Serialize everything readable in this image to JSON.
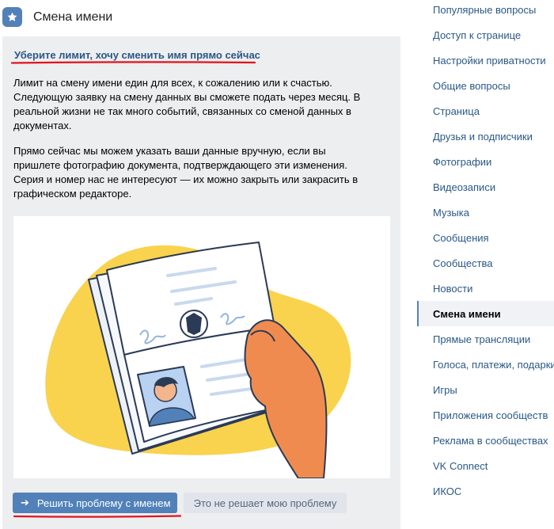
{
  "header": {
    "title": "Смена имени",
    "icon": "star-icon"
  },
  "article": {
    "question": "Уберите лимит, хочу сменить имя прямо сейчас",
    "paragraphs": [
      "Лимит на смену имени един для всех, к сожалению или к счастью. Следующую заявку на смену данных вы сможете подать через месяц. В реальной жизни не так много событий, связанных со сменой данных в документах.",
      "Прямо сейчас мы можем указать ваши данные вручную, если вы пришлете фотографию документа, подтверждающего эти изменения. Серия и номер нас не интересуют — их можно закрыть или закрасить в графическом редакторе."
    ],
    "buttons": {
      "primary": "Решить проблему с именем",
      "secondary": "Это не решает мою проблему"
    }
  },
  "nav": {
    "items": [
      {
        "label": "Популярные вопросы",
        "active": false
      },
      {
        "label": "Доступ к странице",
        "active": false
      },
      {
        "label": "Настройки приватности",
        "active": false
      },
      {
        "label": "Общие вопросы",
        "active": false
      },
      {
        "label": "Страница",
        "active": false
      },
      {
        "label": "Друзья и подписчики",
        "active": false
      },
      {
        "label": "Фотографии",
        "active": false
      },
      {
        "label": "Видеозаписи",
        "active": false
      },
      {
        "label": "Музыка",
        "active": false
      },
      {
        "label": "Сообщения",
        "active": false
      },
      {
        "label": "Сообщества",
        "active": false
      },
      {
        "label": "Новости",
        "active": false
      },
      {
        "label": "Смена имени",
        "active": true
      },
      {
        "label": "Прямые трансляции",
        "active": false
      },
      {
        "label": "Голоса, платежи, подарки",
        "active": false
      },
      {
        "label": "Игры",
        "active": false
      },
      {
        "label": "Приложения сообществ",
        "active": false
      },
      {
        "label": "Реклама в сообществах",
        "active": false
      },
      {
        "label": "VK Connect",
        "active": false
      },
      {
        "label": "ИКОС",
        "active": false
      }
    ]
  },
  "colors": {
    "accent": "#5181b8",
    "link": "#2a5885",
    "annotation": "#e0141c",
    "illustration_yellow": "#f9d34e",
    "hand": "#f08b4f"
  }
}
